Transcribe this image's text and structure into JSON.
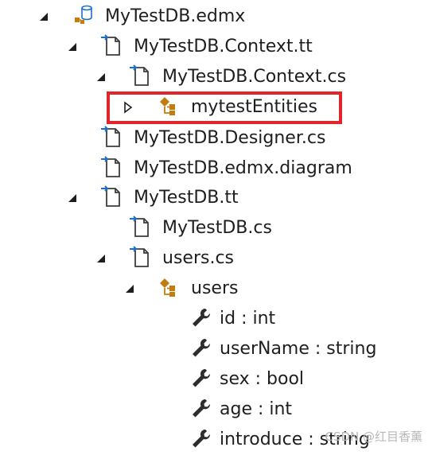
{
  "tree": {
    "items": [
      {
        "label": "MyTestDB.edmx",
        "icon": "database-model-icon",
        "expanded": true
      },
      {
        "label": "MyTestDB.Context.tt",
        "icon": "file-icon",
        "expanded": true
      },
      {
        "label": "MyTestDB.Context.cs",
        "icon": "file-icon",
        "expanded": true
      },
      {
        "label": "mytestEntities",
        "icon": "class-icon",
        "expanded": false
      },
      {
        "label": "MyTestDB.Designer.cs",
        "icon": "file-icon"
      },
      {
        "label": "MyTestDB.edmx.diagram",
        "icon": "file-icon"
      },
      {
        "label": "MyTestDB.tt",
        "icon": "file-icon",
        "expanded": true
      },
      {
        "label": "MyTestDB.cs",
        "icon": "file-icon"
      },
      {
        "label": "users.cs",
        "icon": "file-icon",
        "expanded": true
      },
      {
        "label": "users",
        "icon": "class-icon",
        "expanded": true
      },
      {
        "label": "id : int",
        "icon": "property-wrench-icon"
      },
      {
        "label": "userName : string",
        "icon": "property-wrench-icon"
      },
      {
        "label": "sex : bool",
        "icon": "property-wrench-icon"
      },
      {
        "label": "age : int",
        "icon": "property-wrench-icon"
      },
      {
        "label": "introduce : string",
        "icon": "property-wrench-icon"
      }
    ]
  },
  "highlight": {
    "color": "#e0262a",
    "target": "mytestEntities"
  },
  "watermark": {
    "text": "CSDN @红目香薰"
  },
  "colors": {
    "text": "#1e1e1e",
    "arrow": "#1e1e1e",
    "file_outline": "#3c3c3c",
    "file_link": "#1e6ec8",
    "class_orange": "#c27d0e",
    "wrench": "#2d2d2d"
  }
}
